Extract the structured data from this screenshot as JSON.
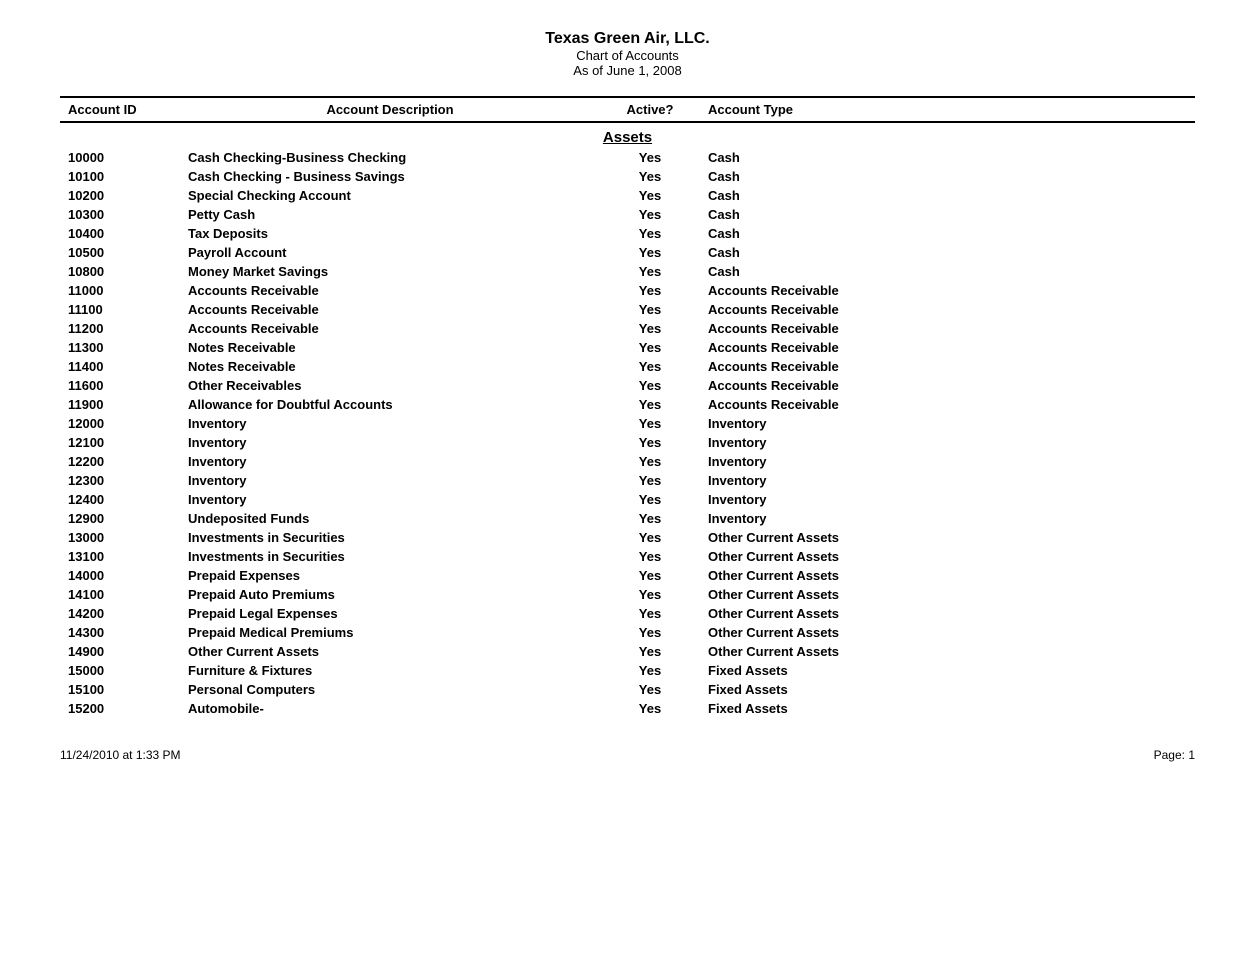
{
  "header": {
    "company": "Texas Green Air, LLC.",
    "title": "Chart of Accounts",
    "date": "As of June 1, 2008"
  },
  "columns": {
    "id": "Account ID",
    "description": "Account Description",
    "active": "Active?",
    "type": "Account Type"
  },
  "sections": [
    {
      "name": "Assets",
      "rows": [
        {
          "id": "10000",
          "description": "Cash Checking-Business Checking",
          "active": "Yes",
          "type": "Cash"
        },
        {
          "id": "10100",
          "description": "Cash Checking - Business Savings",
          "active": "Yes",
          "type": "Cash"
        },
        {
          "id": "10200",
          "description": "Special Checking Account",
          "active": "Yes",
          "type": "Cash"
        },
        {
          "id": "10300",
          "description": "Petty Cash",
          "active": "Yes",
          "type": "Cash"
        },
        {
          "id": "10400",
          "description": "Tax Deposits",
          "active": "Yes",
          "type": "Cash"
        },
        {
          "id": "10500",
          "description": "Payroll Account",
          "active": "Yes",
          "type": "Cash"
        },
        {
          "id": "10800",
          "description": "Money Market Savings",
          "active": "Yes",
          "type": "Cash"
        },
        {
          "id": "11000",
          "description": "Accounts Receivable",
          "active": "Yes",
          "type": "Accounts Receivable"
        },
        {
          "id": "11100",
          "description": "Accounts Receivable",
          "active": "Yes",
          "type": "Accounts Receivable"
        },
        {
          "id": "11200",
          "description": "Accounts Receivable",
          "active": "Yes",
          "type": "Accounts Receivable"
        },
        {
          "id": "11300",
          "description": "Notes Receivable",
          "active": "Yes",
          "type": "Accounts Receivable"
        },
        {
          "id": "11400",
          "description": "Notes Receivable",
          "active": "Yes",
          "type": "Accounts Receivable"
        },
        {
          "id": "11600",
          "description": "Other Receivables",
          "active": "Yes",
          "type": "Accounts Receivable"
        },
        {
          "id": "11900",
          "description": "Allowance for Doubtful Accounts",
          "active": "Yes",
          "type": "Accounts Receivable"
        },
        {
          "id": "12000",
          "description": "Inventory",
          "active": "Yes",
          "type": "Inventory"
        },
        {
          "id": "12100",
          "description": "Inventory",
          "active": "Yes",
          "type": "Inventory"
        },
        {
          "id": "12200",
          "description": "Inventory",
          "active": "Yes",
          "type": "Inventory"
        },
        {
          "id": "12300",
          "description": "Inventory",
          "active": "Yes",
          "type": "Inventory"
        },
        {
          "id": "12400",
          "description": "Inventory",
          "active": "Yes",
          "type": "Inventory"
        },
        {
          "id": "12900",
          "description": "Undeposited Funds",
          "active": "Yes",
          "type": "Inventory"
        },
        {
          "id": "13000",
          "description": "Investments in Securities",
          "active": "Yes",
          "type": "Other Current Assets"
        },
        {
          "id": "13100",
          "description": "Investments in Securities",
          "active": "Yes",
          "type": "Other Current Assets"
        },
        {
          "id": "14000",
          "description": "Prepaid Expenses",
          "active": "Yes",
          "type": "Other Current Assets"
        },
        {
          "id": "14100",
          "description": "Prepaid Auto Premiums",
          "active": "Yes",
          "type": "Other Current Assets"
        },
        {
          "id": "14200",
          "description": "Prepaid Legal Expenses",
          "active": "Yes",
          "type": "Other Current Assets"
        },
        {
          "id": "14300",
          "description": "Prepaid Medical Premiums",
          "active": "Yes",
          "type": "Other Current Assets"
        },
        {
          "id": "14900",
          "description": "Other Current Assets",
          "active": "Yes",
          "type": "Other Current Assets"
        },
        {
          "id": "15000",
          "description": "Furniture & Fixtures",
          "active": "Yes",
          "type": "Fixed Assets"
        },
        {
          "id": "15100",
          "description": "Personal Computers",
          "active": "Yes",
          "type": "Fixed Assets"
        },
        {
          "id": "15200",
          "description": "Automobile-",
          "active": "Yes",
          "type": "Fixed Assets"
        }
      ]
    }
  ],
  "footer": {
    "timestamp": "11/24/2010 at 1:33 PM",
    "page": "Page: 1"
  }
}
